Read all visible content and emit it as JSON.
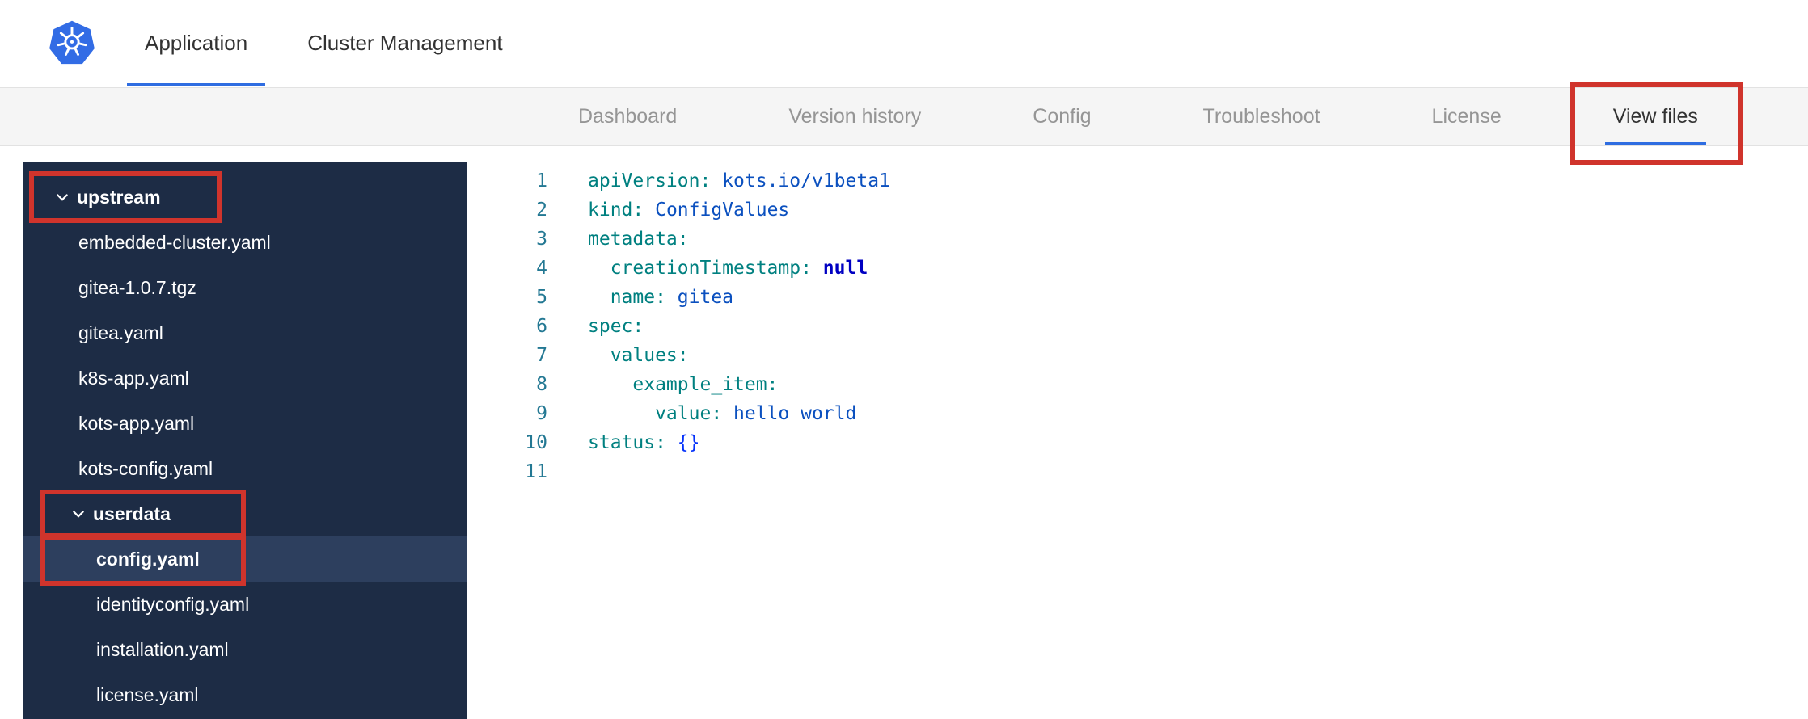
{
  "header": {
    "tabs": [
      {
        "label": "Application",
        "active": true
      },
      {
        "label": "Cluster Management",
        "active": false
      }
    ]
  },
  "subnav": {
    "items": [
      {
        "label": "Dashboard",
        "active": false
      },
      {
        "label": "Version history",
        "active": false
      },
      {
        "label": "Config",
        "active": false
      },
      {
        "label": "Troubleshoot",
        "active": false
      },
      {
        "label": "License",
        "active": false
      },
      {
        "label": "View files",
        "active": true,
        "annotated": true
      }
    ]
  },
  "file_tree": {
    "items": [
      {
        "type": "folder",
        "label": "upstream",
        "depth": 0,
        "expanded": true,
        "ann": "upstream"
      },
      {
        "type": "file",
        "label": "embedded-cluster.yaml",
        "depth": 1
      },
      {
        "type": "file",
        "label": "gitea-1.0.7.tgz",
        "depth": 1
      },
      {
        "type": "file",
        "label": "gitea.yaml",
        "depth": 1
      },
      {
        "type": "file",
        "label": "k8s-app.yaml",
        "depth": 1
      },
      {
        "type": "file",
        "label": "kots-app.yaml",
        "depth": 1
      },
      {
        "type": "file",
        "label": "kots-config.yaml",
        "depth": 1
      },
      {
        "type": "folder",
        "label": "userdata",
        "depth": 1,
        "expanded": true,
        "ann": "userdata"
      },
      {
        "type": "file",
        "label": "config.yaml",
        "depth": 2,
        "selected": true,
        "ann": "config"
      },
      {
        "type": "file",
        "label": "identityconfig.yaml",
        "depth": 2
      },
      {
        "type": "file",
        "label": "installation.yaml",
        "depth": 2
      },
      {
        "type": "file",
        "label": "license.yaml",
        "depth": 2
      }
    ]
  },
  "editor": {
    "language": "yaml",
    "lines": [
      {
        "num": 1,
        "tokens": [
          {
            "c": "key",
            "t": "apiVersion:"
          },
          {
            "c": "str",
            "t": " kots.io/v1beta1"
          }
        ]
      },
      {
        "num": 2,
        "tokens": [
          {
            "c": "key",
            "t": "kind:"
          },
          {
            "c": "str",
            "t": " ConfigValues"
          }
        ]
      },
      {
        "num": 3,
        "tokens": [
          {
            "c": "key",
            "t": "metadata:"
          }
        ]
      },
      {
        "num": 4,
        "tokens": [
          {
            "c": "key",
            "t": "  creationTimestamp:"
          },
          {
            "c": "kw",
            "t": " null"
          }
        ]
      },
      {
        "num": 5,
        "tokens": [
          {
            "c": "key",
            "t": "  name:"
          },
          {
            "c": "str",
            "t": " gitea"
          }
        ]
      },
      {
        "num": 6,
        "tokens": [
          {
            "c": "key",
            "t": "spec:"
          }
        ]
      },
      {
        "num": 7,
        "tokens": [
          {
            "c": "key",
            "t": "  values:"
          }
        ]
      },
      {
        "num": 8,
        "tokens": [
          {
            "c": "key",
            "t": "    example_item:"
          }
        ]
      },
      {
        "num": 9,
        "tokens": [
          {
            "c": "key",
            "t": "      value:"
          },
          {
            "c": "str",
            "t": " hello world"
          }
        ]
      },
      {
        "num": 10,
        "tokens": [
          {
            "c": "key",
            "t": "status:"
          },
          {
            "c": "punct",
            "t": " {}"
          }
        ]
      },
      {
        "num": 11,
        "tokens": []
      }
    ]
  },
  "icons": {
    "logo": "kubernetes-helm-wheel",
    "folder_chevron": "chevron-down"
  },
  "colors": {
    "accent_blue": "#2f6de1",
    "annotation_red": "#d0342c",
    "k8s_blue": "#326ce5",
    "sidebar_bg": "#1d2c45",
    "sidebar_selected_bg": "#2d3f5e",
    "subnav_bg": "#f5f5f5",
    "nav_text": "#959595",
    "nav_text_active": "#323232",
    "line_number": "#237893",
    "token_key": "#008080",
    "token_string": "#0b50bf",
    "token_keyword": "#0000c2",
    "token_punct": "#0431fa"
  }
}
